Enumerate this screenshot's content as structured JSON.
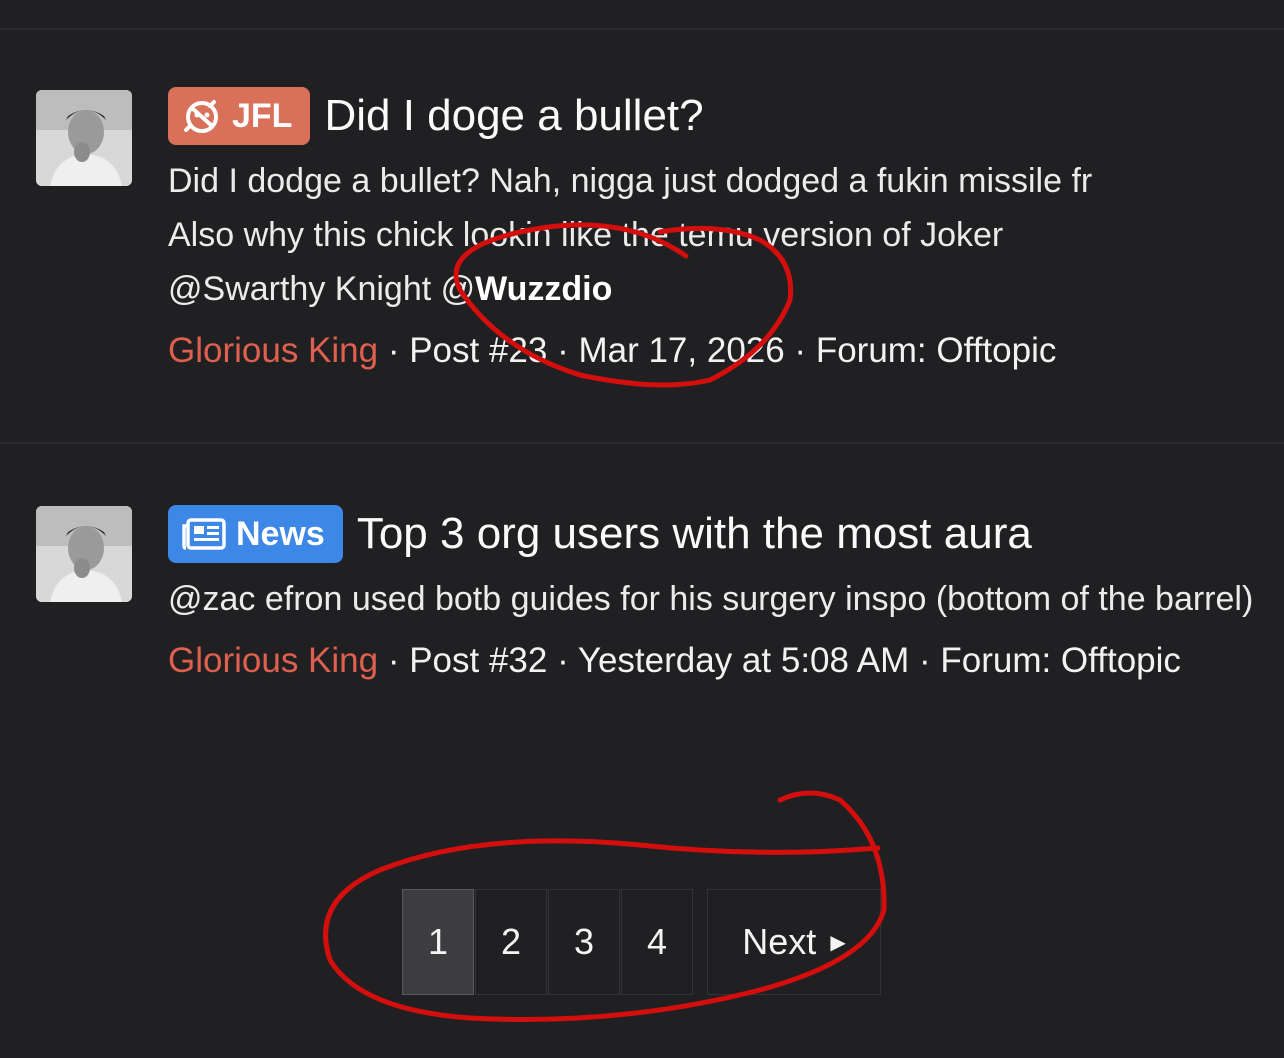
{
  "results": [
    {
      "prefix": "JFL",
      "prefix_color": "#d9705a",
      "prefix_icon": "jfl-emoji-icon",
      "title": "Did I doge a bullet?",
      "snippet_line1": "Did I dodge a bullet? Nah, nigga just dodged a fukin missile fr",
      "snippet_line2": "Also why this chick lookin like the temu version of Joker",
      "snippet_line3a": "@Swarthy Knight @",
      "snippet_line3b": "Wuzzdio",
      "user": "Glorious King",
      "meta": " · Post #23 · Mar 17, 2026 · Forum: Offtopic"
    },
    {
      "prefix": "News",
      "prefix_color": "#3d87e6",
      "prefix_icon": "newspaper-icon",
      "title": "Top 3 org users with the most aura",
      "snippet": "@zac efron used botb guides for his surgery inspo (bottom of the barrel)",
      "user": "Glorious King",
      "meta": " · Post #32 · Yesterday at 5:08 AM · Forum: Offtopic"
    }
  ],
  "pagination": {
    "pages": [
      "1",
      "2",
      "3",
      "4"
    ],
    "current": "1",
    "next_label": "Next",
    "next_icon": "caret-right-icon"
  },
  "colors": {
    "background": "#202022",
    "username": "#e0604f",
    "annotation": "#d40d0d"
  }
}
